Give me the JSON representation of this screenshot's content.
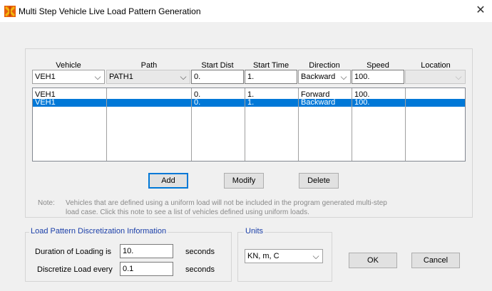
{
  "window": {
    "title": "Multi Step Vehicle Live Load Pattern Generation",
    "close_glyph": "✕",
    "icon": "app-logo-icon"
  },
  "table": {
    "headers": [
      "Vehicle",
      "Path",
      "Start Dist",
      "Start Time",
      "Direction",
      "Speed",
      "Location"
    ],
    "edit_row": {
      "vehicle": "VEH1",
      "path": "PATH1",
      "start_dist": "0.",
      "start_time": "1.",
      "direction": "Backward",
      "speed": "100.",
      "location": ""
    },
    "rows": [
      {
        "vehicle": "VEH1",
        "path": "",
        "start_dist": "0.",
        "start_time": "1.",
        "direction": "Forward",
        "speed": "100.",
        "location": "",
        "selected": false
      },
      {
        "vehicle": "VEH1",
        "path": "",
        "start_dist": "0.",
        "start_time": "1.",
        "direction": "Backward",
        "speed": "100.",
        "location": "",
        "selected": true
      }
    ]
  },
  "buttons": {
    "add": "Add",
    "modify": "Modify",
    "delete": "Delete",
    "ok": "OK",
    "cancel": "Cancel"
  },
  "note": {
    "label": "Note:",
    "line1": "Vehicles that are defined using a uniform load will not be included in the program generated multi-step",
    "line2": "load case.  Click this note to see a list of vehicles defined using uniform loads."
  },
  "discretization": {
    "title": "Load Pattern Discretization Information",
    "duration_label": "Duration of Loading is",
    "duration_value": "10.",
    "duration_unit": "seconds",
    "discretize_label": "Discretize Load every",
    "discretize_value": "0.1",
    "discretize_unit": "seconds"
  },
  "units": {
    "title": "Units",
    "selected": "KN, m, C"
  },
  "colors": {
    "selection": "#0078d7",
    "legend": "#1a3ea8",
    "icon_orange": "#e8610c",
    "icon_yellow": "#f2b70f"
  }
}
